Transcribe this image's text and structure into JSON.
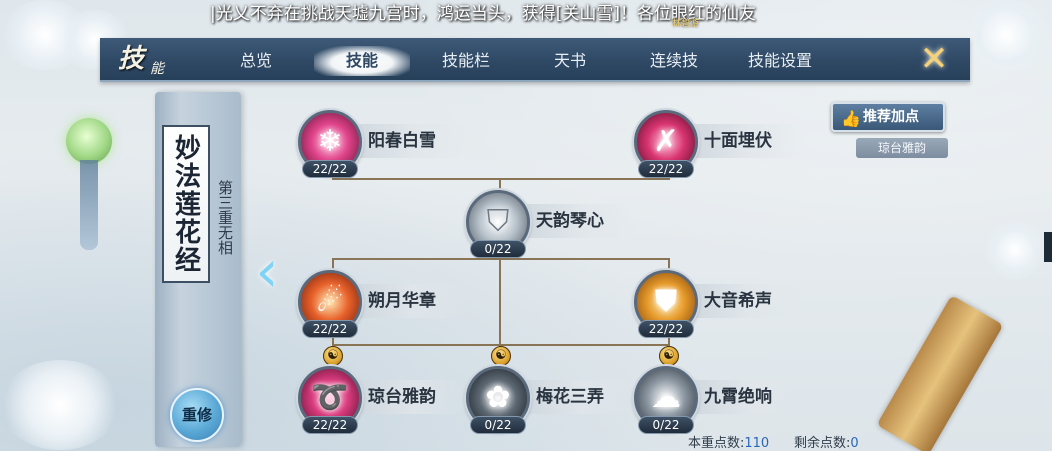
{
  "marquee": {
    "text": "|光乂不弃在挑战天墟九宫时，鸿运当头，获得[关山雪]！各位眼红的仙友",
    "name_tag": "林碧游"
  },
  "header": {
    "logo": "技",
    "logo_small": "能",
    "tabs": [
      {
        "label": "总览",
        "active": false
      },
      {
        "label": "技能",
        "active": true
      },
      {
        "label": "技能栏",
        "active": false
      },
      {
        "label": "天书",
        "active": false
      },
      {
        "label": "连续技",
        "active": false
      },
      {
        "label": "技能设置",
        "active": false
      }
    ],
    "close_icon": "✕"
  },
  "book": {
    "title": "妙法莲花经",
    "subtitle": "第三重无相",
    "reset_label": "重修"
  },
  "recommend": {
    "button_label": "推荐加点",
    "sub_label": "琼台雅韵"
  },
  "skills": [
    {
      "name": "阳春白雪",
      "count": "22/22",
      "icon": "snowflake-icon",
      "color": "#e0438a"
    },
    {
      "name": "十面埋伏",
      "count": "22/22",
      "icon": "crossed-blades-icon",
      "color": "#d8336f"
    },
    {
      "name": "天韵琴心",
      "count": "0/22",
      "icon": "shield-icon",
      "color": "#9aa6b1"
    },
    {
      "name": "朔月华章",
      "count": "22/22",
      "icon": "flame-icon",
      "color": "#e8612a"
    },
    {
      "name": "大音希声",
      "count": "22/22",
      "icon": "golden-shield-icon",
      "color": "#e79b2b"
    },
    {
      "name": "琼台雅韵",
      "count": "22/22",
      "icon": "swirl-icon",
      "color": "#d83a7c"
    },
    {
      "name": "梅花三弄",
      "count": "0/22",
      "icon": "blossom-strike-icon",
      "color": "#5d6873"
    },
    {
      "name": "九霄绝响",
      "count": "0/22",
      "icon": "cloud-burst-icon",
      "color": "#8d98a3"
    }
  ],
  "points": {
    "current_label": "本重点数:",
    "current_value": "110",
    "remaining_label": "剩余点数:",
    "remaining_value": "0"
  }
}
